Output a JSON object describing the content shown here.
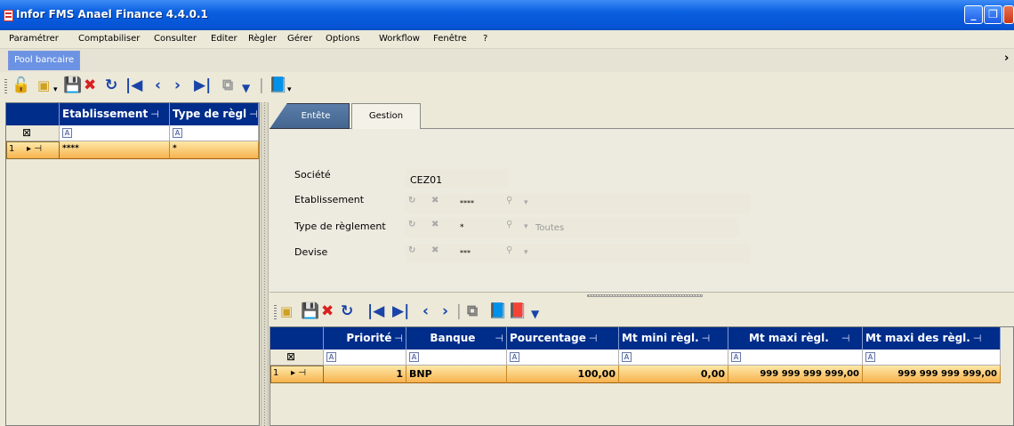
{
  "window": {
    "title": "Infor FMS Anael Finance 4.4.0.1"
  },
  "menu": [
    "Paramétrer",
    "Comptabiliser",
    "Consulter",
    "Editer",
    "Règler",
    "Gérer",
    "Options",
    "Workflow",
    "Fenêtre",
    "?"
  ],
  "doc_tab": "Pool bancaire",
  "left_grid": {
    "headers": [
      "Etablissement",
      "Type de règl"
    ],
    "filter_glyph": "A",
    "row_number": "1",
    "row": [
      "****",
      "*"
    ]
  },
  "form_tabs": [
    "Entête",
    "Gestion"
  ],
  "form": {
    "societe_label": "Société",
    "societe_value": "CEZ01",
    "etablissement_label": "Etablissement",
    "etablissement_value": "****",
    "type_label": "Type de règlement",
    "type_value": "*",
    "type_extra": "Toutes",
    "devise_label": "Devise",
    "devise_value": "***"
  },
  "sub_grid": {
    "headers": [
      "Priorité",
      "Banque",
      "Pourcentage",
      "Mt mini règl.",
      "Mt maxi règl.",
      "Mt maxi des règl."
    ],
    "filter_glyph": "A",
    "row_number": "1",
    "row": [
      "1",
      "BNP",
      "100,00",
      "0,00",
      "999 999 999 999,00",
      "999 999 999 999,00"
    ]
  },
  "colors": {
    "selected_row": "#f7b24e",
    "grid_header": "#002c8a",
    "titlebar": "#0554d4"
  }
}
